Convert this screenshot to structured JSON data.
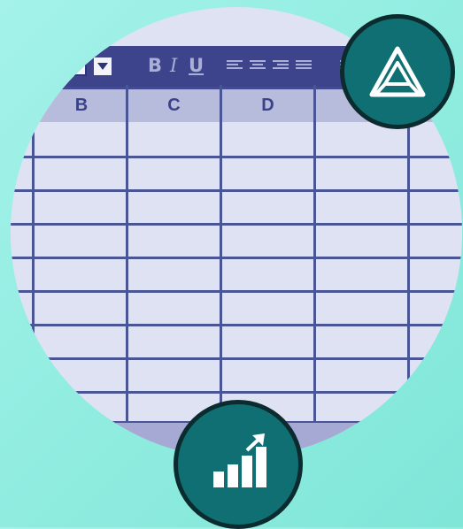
{
  "toolbar": {
    "bold_label": "B",
    "italic_label": "I",
    "underline_label": "U"
  },
  "columns": [
    "B",
    "C",
    "D"
  ],
  "colors": {
    "background": "#8fecdf",
    "toolbar": "#3d448c",
    "header": "#b8bcdc",
    "cell": "#dfe2f2",
    "badge": "#0f6f72",
    "badge_border": "#0b2b2e"
  },
  "icons": {
    "top_badge": "triforce-triangle-icon",
    "bottom_badge": "growth-chart-icon"
  }
}
